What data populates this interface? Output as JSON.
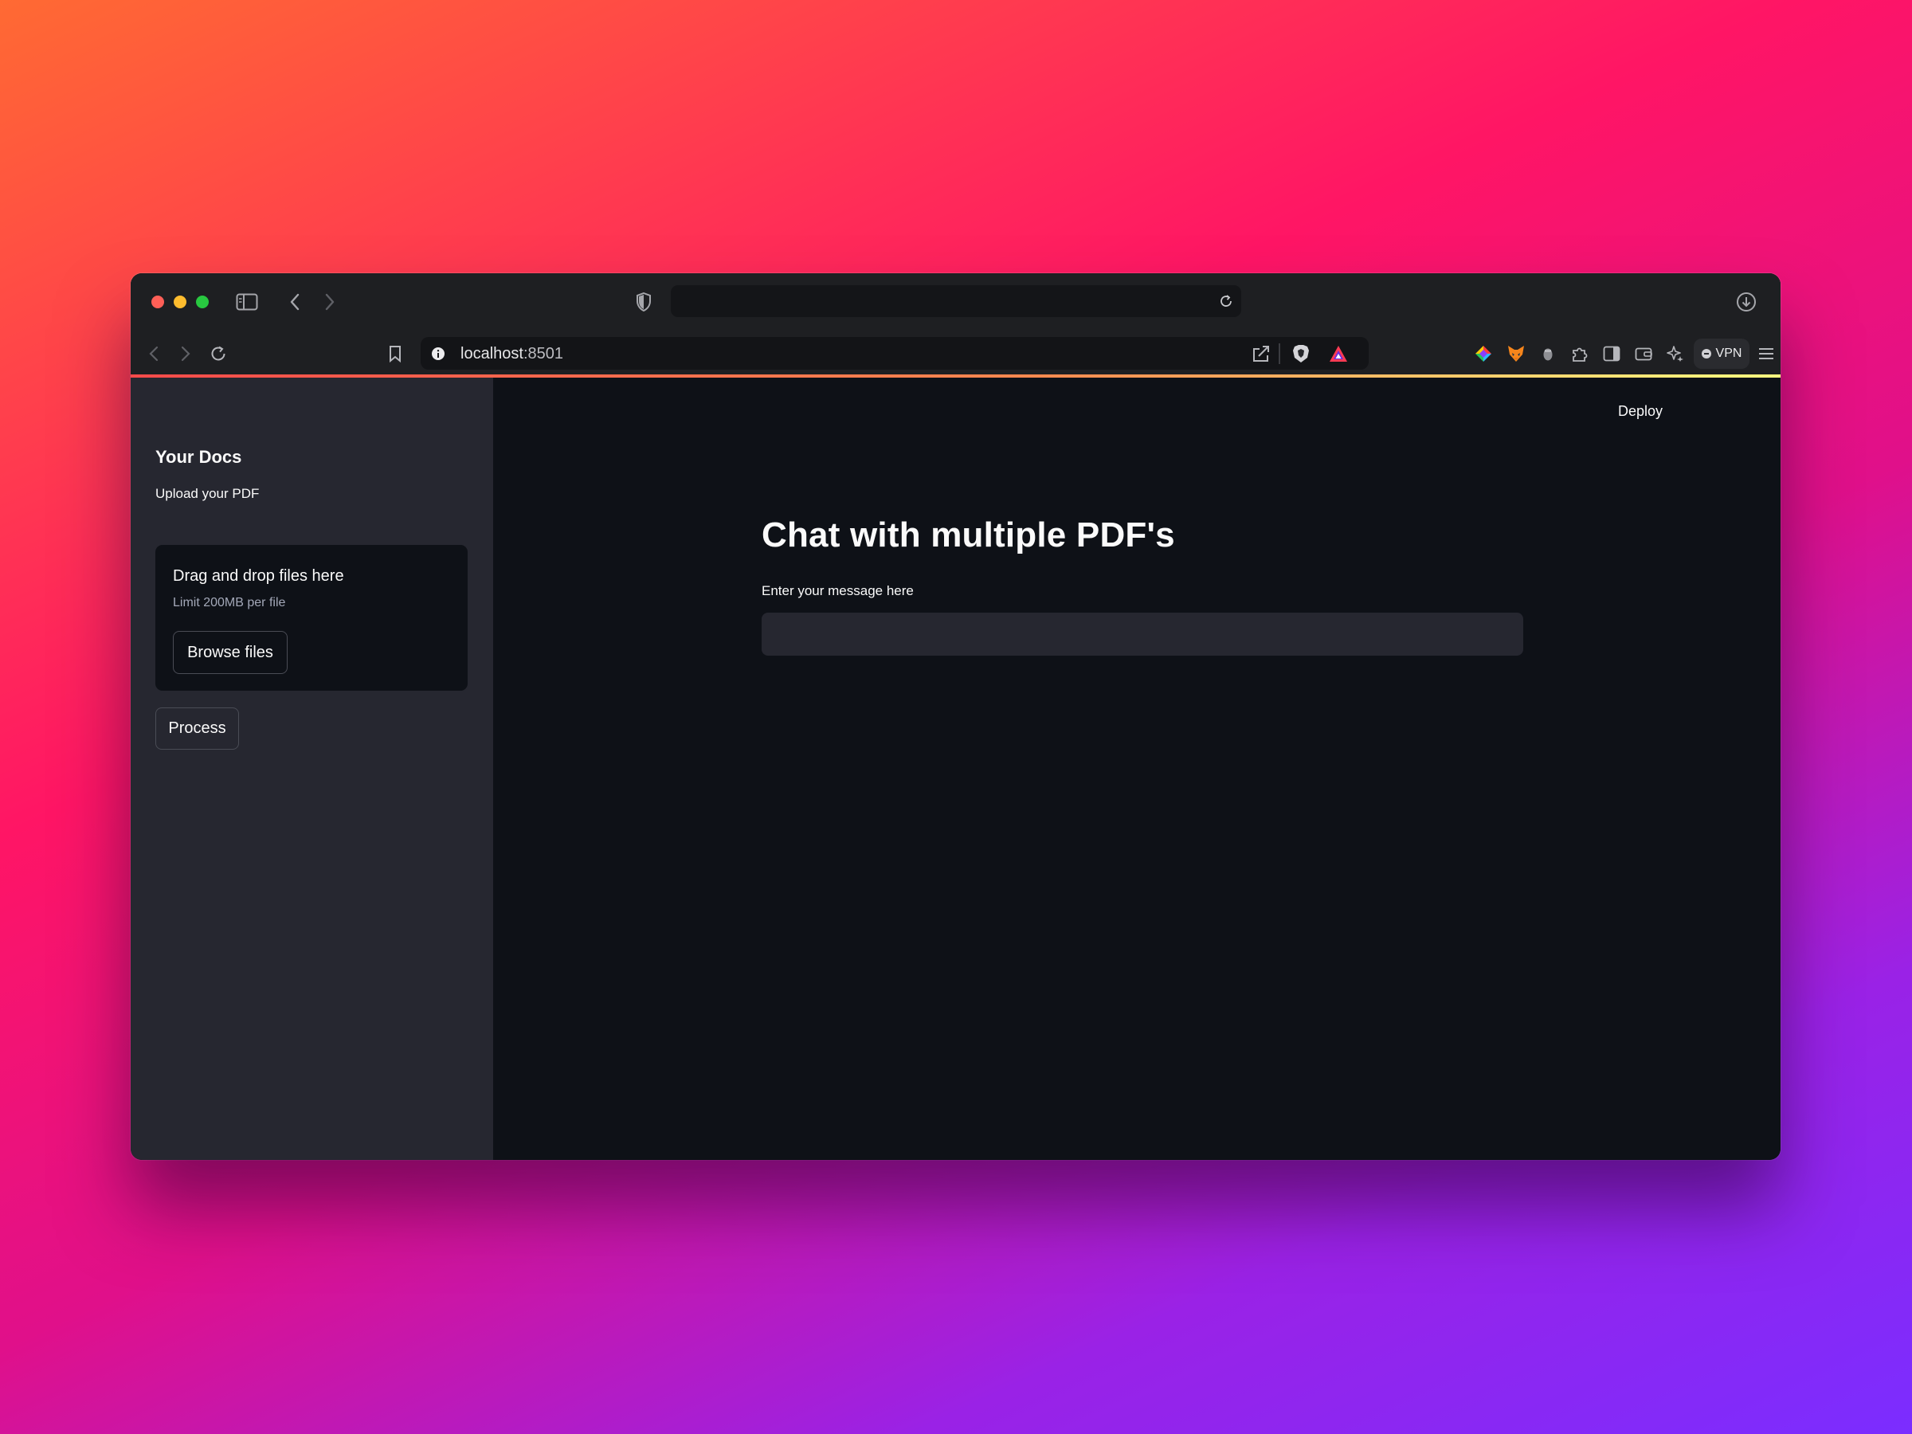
{
  "browser": {
    "safari_address": "",
    "url_host": "localhost",
    "url_port": ":8501",
    "vpn_label": "VPN"
  },
  "app": {
    "deploy_label": "Deploy"
  },
  "sidebar": {
    "title": "Your Docs",
    "upload_label": "Upload your PDF",
    "dropzone_title": "Drag and drop files here",
    "dropzone_limit": "Limit 200MB per file",
    "browse_label": "Browse files",
    "process_label": "Process"
  },
  "main": {
    "title": "Chat with multiple PDF's",
    "input_label": "Enter your message here",
    "input_value": ""
  },
  "colors": {
    "accent_red": "#ff4b4b",
    "background": "#0e1117",
    "sidebar_bg": "#262730"
  }
}
